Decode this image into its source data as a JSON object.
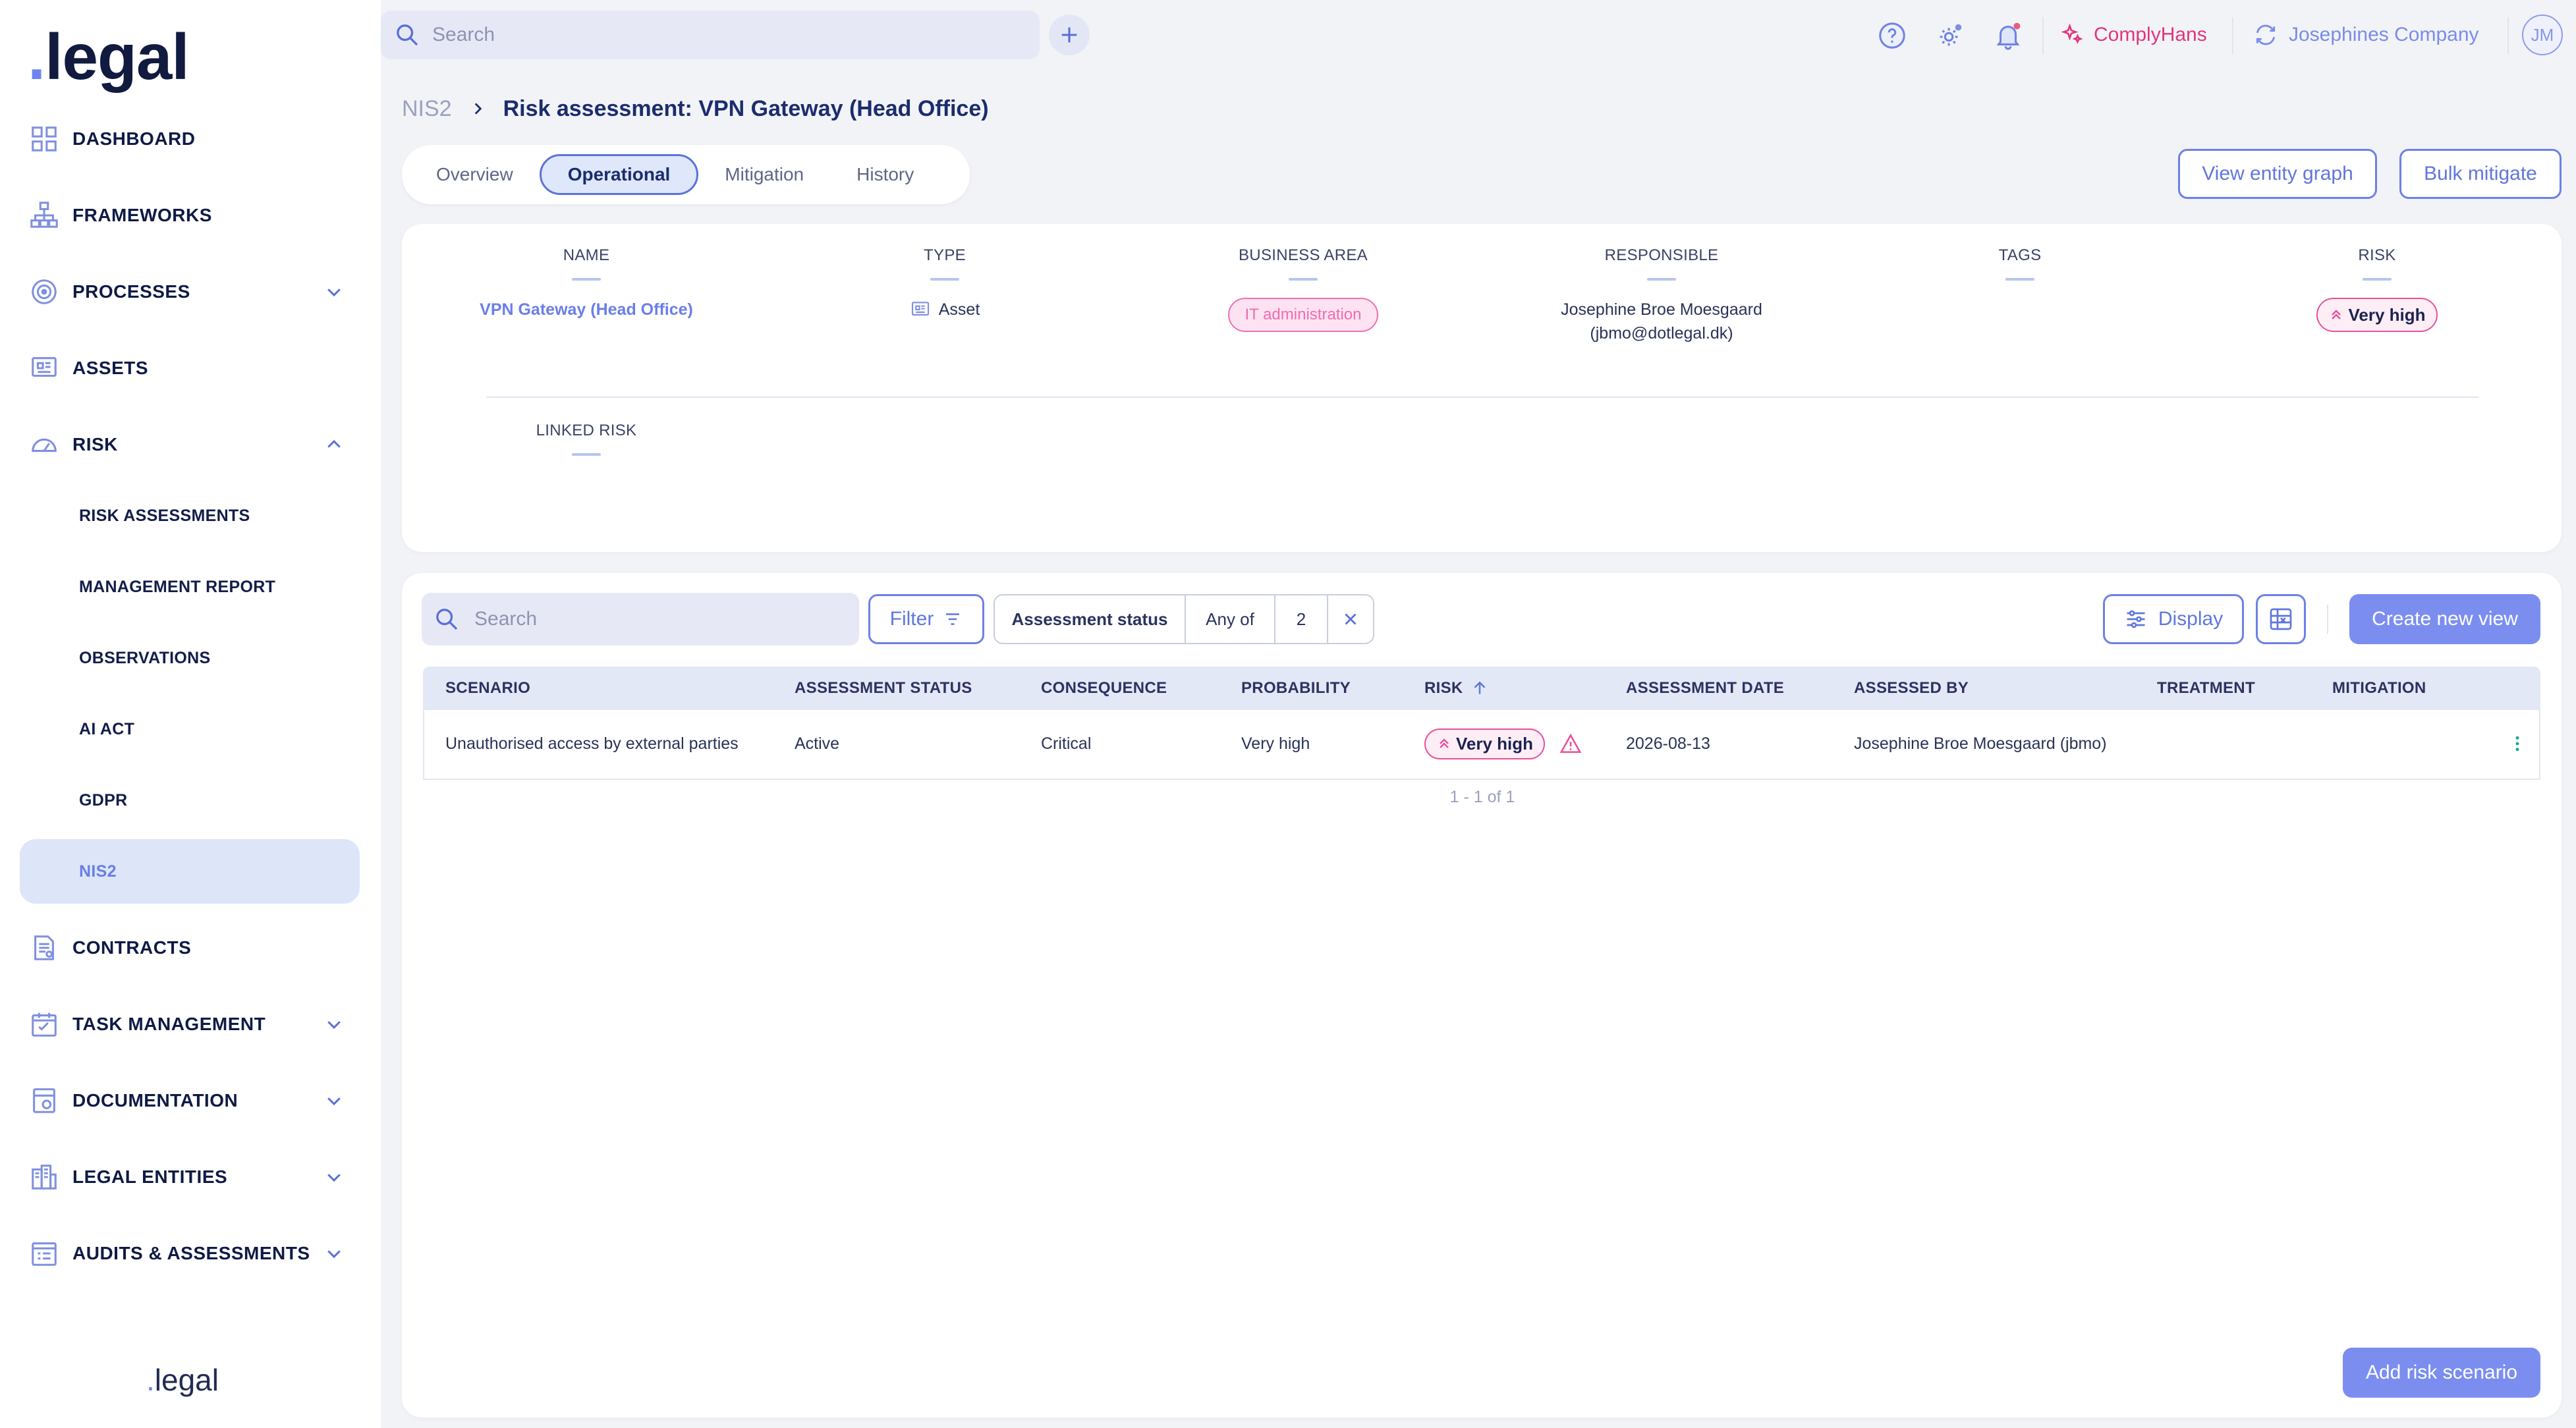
{
  "brand": {
    "logo_dot": ".",
    "logo_text": "legal"
  },
  "sidebar": {
    "items": [
      {
        "label": "DASHBOARD",
        "icon": "dashboard-icon",
        "has_chevron": false
      },
      {
        "label": "FRAMEWORKS",
        "icon": "frameworks-icon",
        "has_chevron": false
      },
      {
        "label": "PROCESSES",
        "icon": "processes-icon",
        "has_chevron": true
      },
      {
        "label": "ASSETS",
        "icon": "assets-icon",
        "has_chevron": false
      },
      {
        "label": "RISK",
        "icon": "risk-gauge-icon",
        "has_chevron": true,
        "expanded": true
      },
      {
        "label": "CONTRACTS",
        "icon": "contracts-icon",
        "has_chevron": false
      },
      {
        "label": "TASK MANAGEMENT",
        "icon": "task-icon",
        "has_chevron": true
      },
      {
        "label": "DOCUMENTATION",
        "icon": "documentation-icon",
        "has_chevron": true
      },
      {
        "label": "LEGAL ENTITIES",
        "icon": "legal-entities-icon",
        "has_chevron": true
      },
      {
        "label": "AUDITS & ASSESSMENTS",
        "icon": "audits-icon",
        "has_chevron": true
      }
    ],
    "risk_subitems": [
      {
        "label": "RISK ASSESSMENTS"
      },
      {
        "label": "MANAGEMENT REPORT"
      },
      {
        "label": "OBSERVATIONS"
      },
      {
        "label": "AI ACT"
      },
      {
        "label": "GDPR"
      },
      {
        "label": "NIS2",
        "active": true
      }
    ],
    "footer_logo_dot": ".",
    "footer_logo_text": "legal"
  },
  "topbar": {
    "search_placeholder": "Search",
    "assistant_label": "ComplyHans",
    "company_label": "Josephines Company",
    "avatar_initials": "JM"
  },
  "breadcrumb": {
    "root": "NIS2",
    "title": "Risk assessment: VPN Gateway (Head Office)"
  },
  "tabs": [
    {
      "label": "Overview",
      "active": false
    },
    {
      "label": "Operational",
      "active": true
    },
    {
      "label": "Mitigation",
      "active": false
    },
    {
      "label": "History",
      "active": false
    }
  ],
  "actions": {
    "view_graph": "View entity graph",
    "bulk_mitigate": "Bulk mitigate"
  },
  "info": {
    "name_label": "NAME",
    "name_value": "VPN Gateway (Head Office)",
    "type_label": "TYPE",
    "type_value": "Asset",
    "business_area_label": "BUSINESS AREA",
    "business_area_value": "IT administration",
    "responsible_label": "RESPONSIBLE",
    "responsible_name": "Josephine Broe Moesgaard",
    "responsible_email": "(jbmo@dotlegal.dk)",
    "tags_label": "TAGS",
    "risk_label": "RISK",
    "risk_value": "Very high",
    "linked_risk_label": "LINKED RISK"
  },
  "table_toolbar": {
    "search_placeholder": "Search",
    "filter_label": "Filter",
    "chip_field": "Assessment status",
    "chip_operator": "Any of",
    "chip_count": "2",
    "display_label": "Display",
    "create_view_label": "Create new view"
  },
  "table": {
    "columns": [
      "SCENARIO",
      "ASSESSMENT STATUS",
      "CONSEQUENCE",
      "PROBABILITY",
      "RISK",
      "ASSESSMENT DATE",
      "ASSESSED BY",
      "TREATMENT",
      "MITIGATION"
    ],
    "rows": [
      {
        "scenario": "Unauthorised access by external parties",
        "status": "Active",
        "consequence": "Critical",
        "probability": "Very high",
        "risk": "Very high",
        "date": "2026-08-13",
        "assessed_by": "Josephine Broe Moesgaard (jbmo)",
        "treatment": "",
        "mitigation": ""
      }
    ],
    "pagination": "1 - 1 of 1"
  },
  "add_scenario_label": "Add risk scenario",
  "colors": {
    "accent": "#6c81e6",
    "accent_fill": "#7b8ef0",
    "risk_pink": "#e8509a",
    "comply_pink": "#e0357f",
    "active_nav_bg": "#dde6f8"
  }
}
